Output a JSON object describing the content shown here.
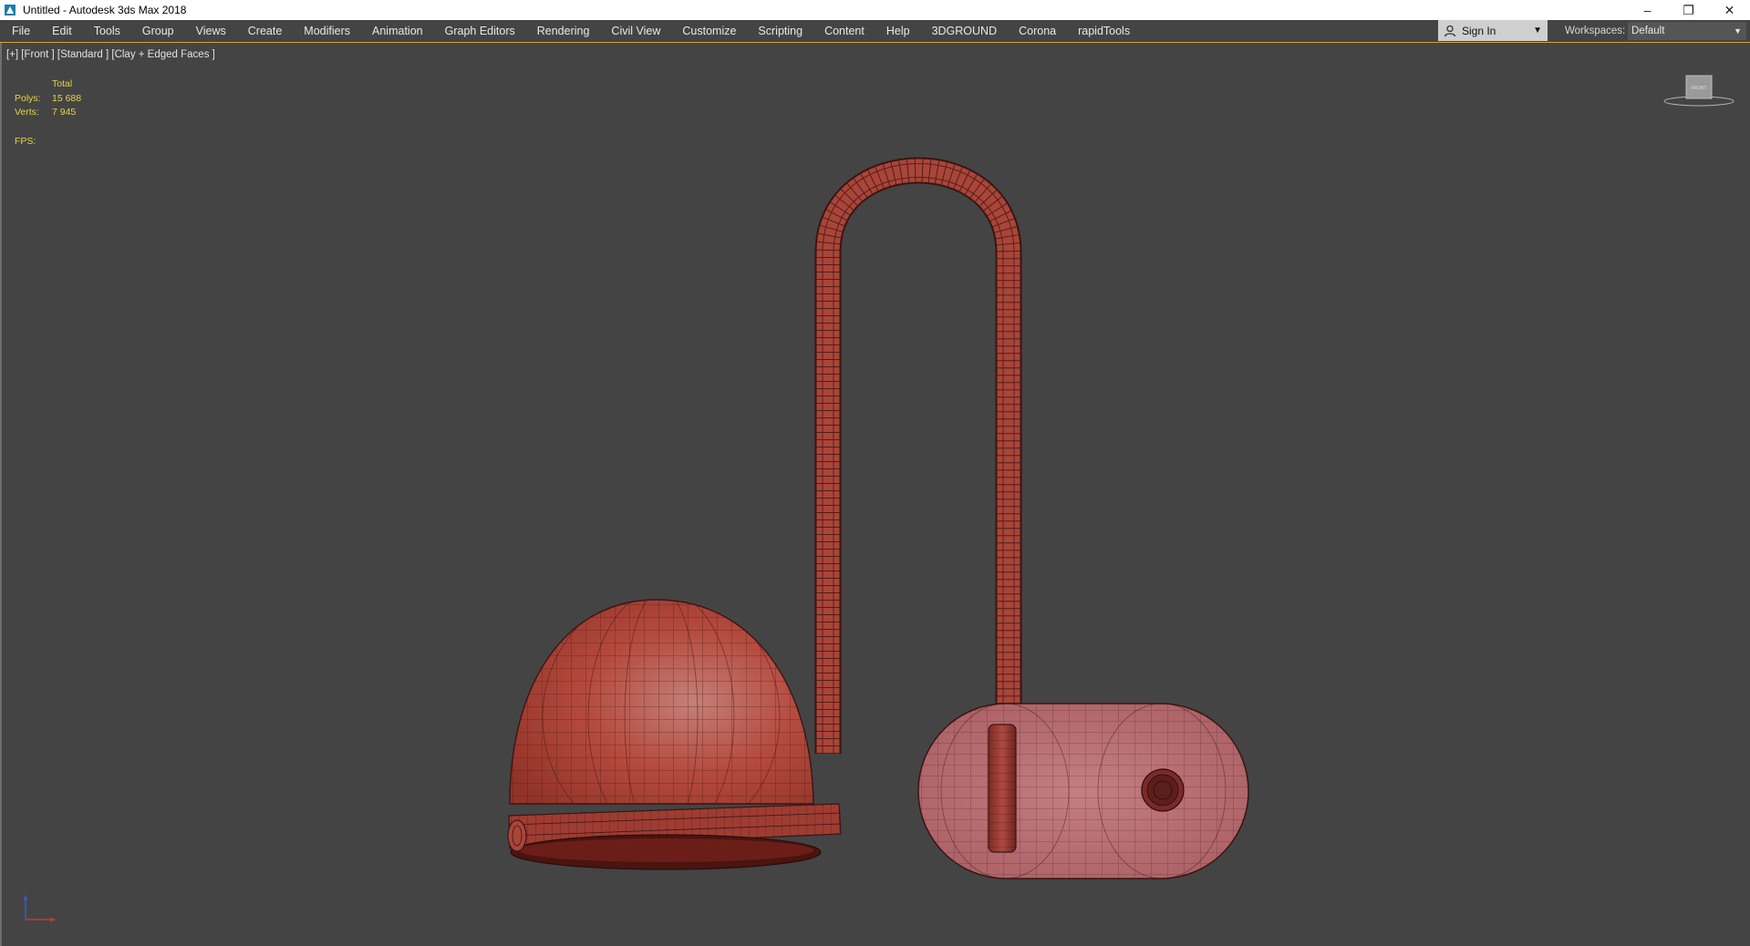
{
  "window": {
    "title": "Untitled - Autodesk 3ds Max 2018",
    "controls": [
      "minimize",
      "restore",
      "close"
    ]
  },
  "menu": {
    "items": [
      "File",
      "Edit",
      "Tools",
      "Group",
      "Views",
      "Create",
      "Modifiers",
      "Animation",
      "Graph Editors",
      "Rendering",
      "Civil View",
      "Customize",
      "Scripting",
      "Content",
      "Help",
      "3DGROUND",
      "Corona",
      "rapidTools"
    ],
    "sign_in": "Sign In",
    "workspaces_label": "Workspaces:",
    "workspace_value": "Default"
  },
  "viewport": {
    "label": "[+] [Front ] [Standard ] [Clay + Edged Faces ]",
    "stats": {
      "total_label": "Total",
      "polys_label": "Polys:",
      "polys_value": "15 688",
      "verts_label": "Verts:",
      "verts_value": "7 945",
      "fps_label": "FPS:"
    },
    "viewcube_label": "FRONT"
  },
  "colors": {
    "background": "#444444",
    "model_red": "#b34a3e",
    "wire": "#3a1512",
    "stats_yellow": "#e6d24a",
    "menu_accent": "#d0a23a"
  }
}
